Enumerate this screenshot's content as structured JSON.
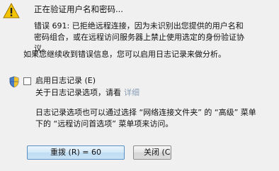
{
  "dialog": {
    "status": "正在验证用户名和密码...",
    "error_lines": [
      "错误 691: 已拒绝远程连接，因为未识别出您提供的用户名和",
      "密码组合，或在远程访问服务器上禁止使用选定的身份验证协",
      "议。"
    ],
    "hint": "如果您继续收到错误信息，您可以启用日志记录来做分析。",
    "logging_checkbox": {
      "label": "启用日志记录 (E)",
      "checked": false
    },
    "about_logging": "关于日志记录选项，请看",
    "details_link": "详细",
    "description_lines": [
      "日志记录选项也可以通过选择 “网络连接文件夹” 的 “高级” 菜单",
      "下的 “远程访问首选项” 菜单项来访问。"
    ],
    "buttons": {
      "redial": "重拨 (R) = 60",
      "close": "关闭 (C)"
    }
  }
}
